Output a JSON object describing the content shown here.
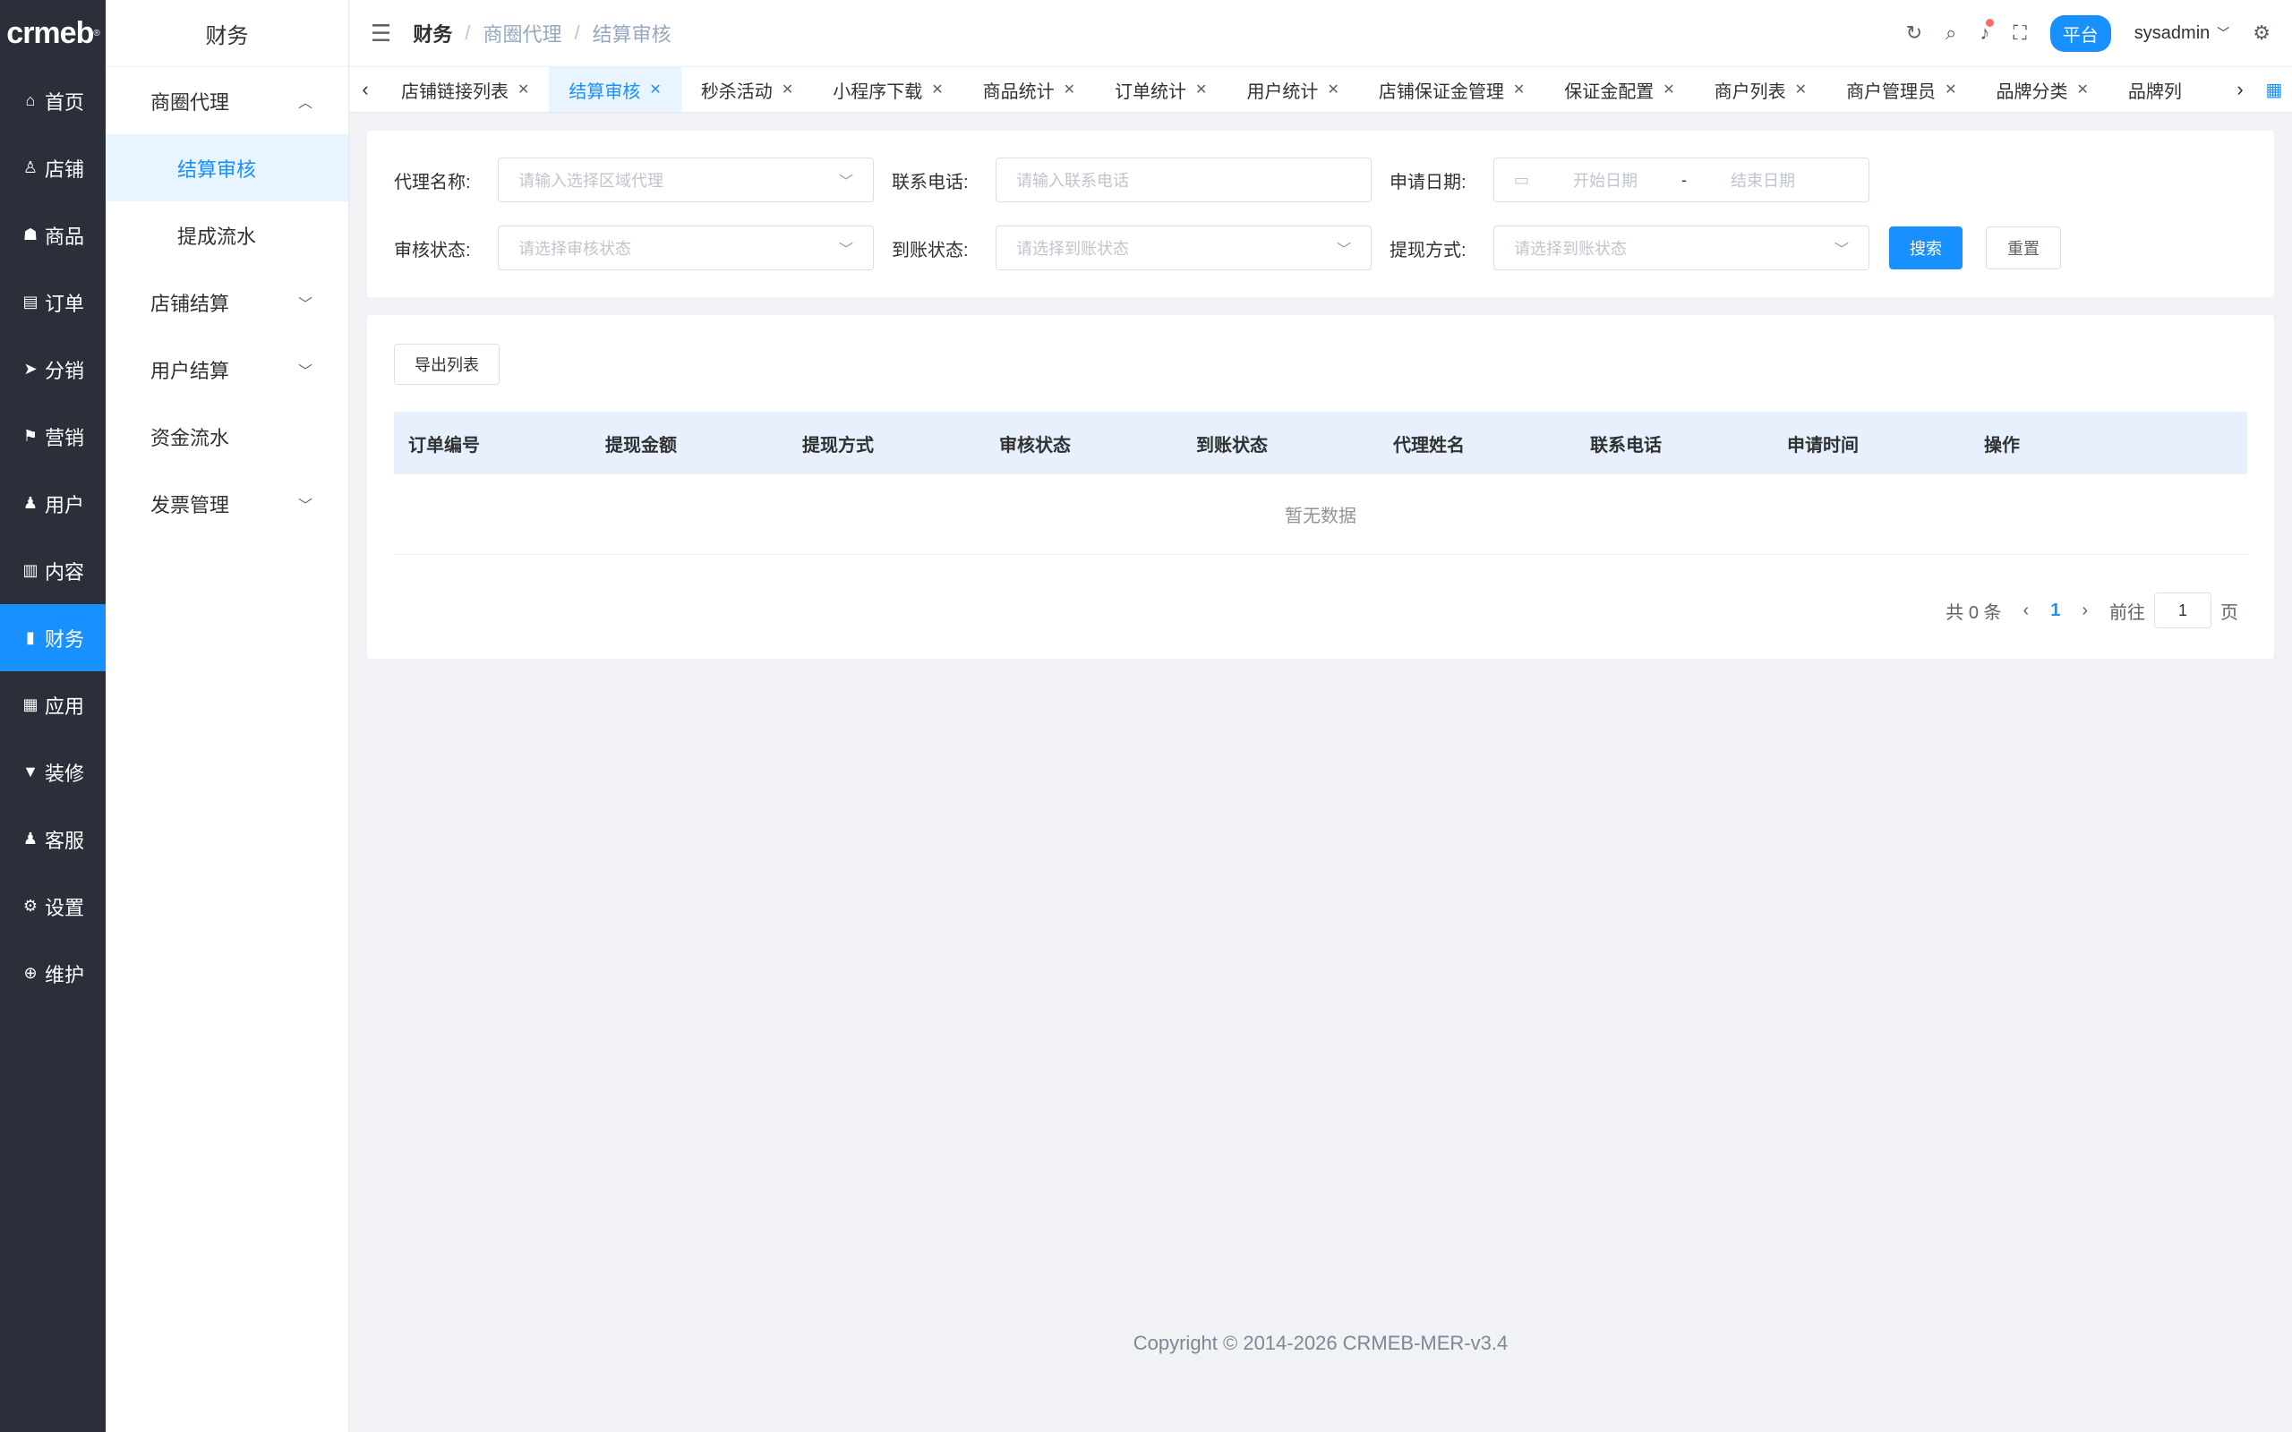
{
  "brand": {
    "logo": "crmeb",
    "mark": "®"
  },
  "rail": [
    {
      "icon": "⌂",
      "label": "首页"
    },
    {
      "icon": "♙",
      "label": "店铺"
    },
    {
      "icon": "☗",
      "label": "商品"
    },
    {
      "icon": "▤",
      "label": "订单"
    },
    {
      "icon": "➤",
      "label": "分销"
    },
    {
      "icon": "⚑",
      "label": "营销"
    },
    {
      "icon": "♟",
      "label": "用户"
    },
    {
      "icon": "▥",
      "label": "内容"
    },
    {
      "icon": "▮",
      "label": "财务"
    },
    {
      "icon": "▦",
      "label": "应用"
    },
    {
      "icon": "▼",
      "label": "装修"
    },
    {
      "icon": "♟",
      "label": "客服"
    },
    {
      "icon": "⚙",
      "label": "设置"
    },
    {
      "icon": "⊕",
      "label": "维护"
    }
  ],
  "sidebar": {
    "title": "财务",
    "group1": "商圈代理",
    "sub1": "结算审核",
    "sub2": "提成流水",
    "group2": "店铺结算",
    "group3": "用户结算",
    "group4": "资金流水",
    "group5": "发票管理"
  },
  "header": {
    "crumb1": "财务",
    "crumb2": "商圈代理",
    "crumb3": "结算审核",
    "platform": "平台",
    "username": "sysadmin"
  },
  "tags": [
    {
      "label": "店铺链接列表"
    },
    {
      "label": "结算审核"
    },
    {
      "label": "秒杀活动"
    },
    {
      "label": "小程序下载"
    },
    {
      "label": "商品统计"
    },
    {
      "label": "订单统计"
    },
    {
      "label": "用户统计"
    },
    {
      "label": "店铺保证金管理"
    },
    {
      "label": "保证金配置"
    },
    {
      "label": "商户列表"
    },
    {
      "label": "商户管理员"
    },
    {
      "label": "品牌分类"
    },
    {
      "label": "品牌列"
    }
  ],
  "filters": {
    "agent_label": "代理名称:",
    "agent_placeholder": "请输入选择区域代理",
    "phone_label": "联系电话:",
    "phone_placeholder": "请输入联系电话",
    "date_label": "申请日期:",
    "date_start": "开始日期",
    "date_sep": "-",
    "date_end": "结束日期",
    "audit_label": "审核状态:",
    "audit_placeholder": "请选择审核状态",
    "arrival_label": "到账状态:",
    "arrival_placeholder": "请选择到账状态",
    "method_label": "提现方式:",
    "method_placeholder": "请选择到账状态",
    "search_btn": "搜索",
    "reset_btn": "重置"
  },
  "table": {
    "export_btn": "导出列表",
    "columns": [
      "订单编号",
      "提现金额",
      "提现方式",
      "审核状态",
      "到账状态",
      "代理姓名",
      "联系电话",
      "申请时间",
      "操作"
    ],
    "empty": "暂无数据"
  },
  "pager": {
    "total": "共 0 条",
    "current": "1",
    "goto": "前往",
    "page_value": "1",
    "page_suffix": "页"
  },
  "footer": "Copyright © 2014-2026 CRMEB-MER-v3.4"
}
